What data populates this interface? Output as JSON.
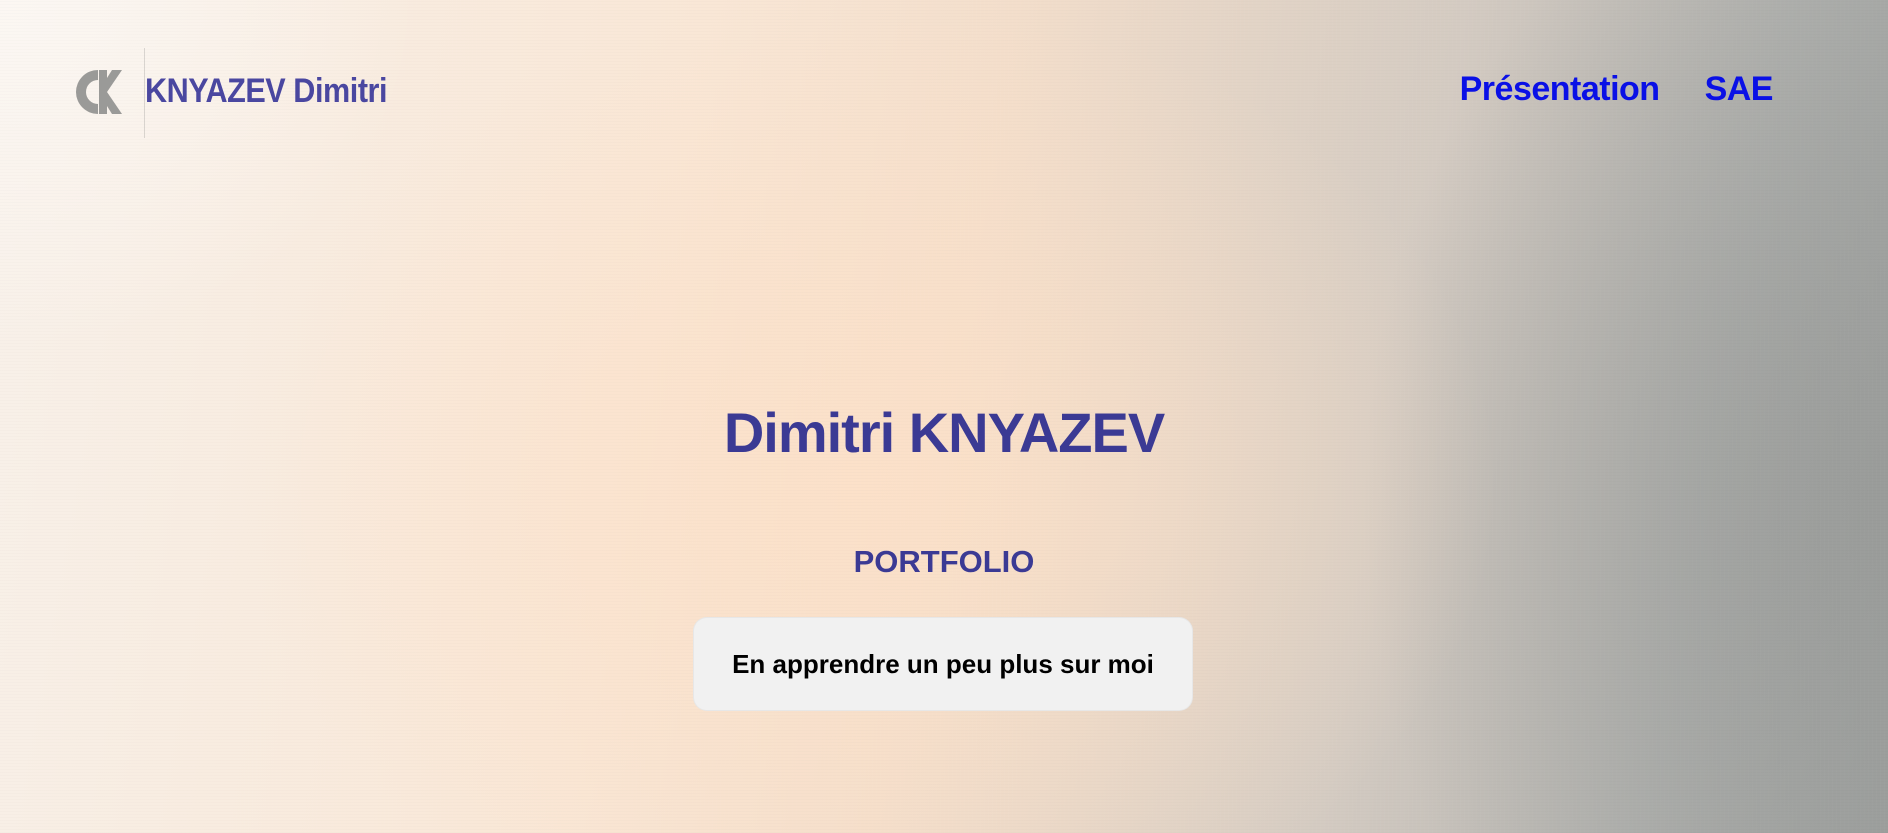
{
  "header": {
    "logo_icon": "ck-monogram-icon",
    "brand_name": "KNYAZEV Dimitri",
    "nav": [
      {
        "label": "Présentation"
      },
      {
        "label": "SAE"
      }
    ]
  },
  "hero": {
    "title": "Dimitri KNYAZEV",
    "subtitle": "PORTFOLIO",
    "cta_label": "En apprendre un peu plus sur moi"
  },
  "colors": {
    "brand": "#4a47a0",
    "heading": "#3b3a94",
    "nav_link": "#0a10e6",
    "button_bg": "#f1f1f1",
    "logo_gray": "#9a9a98"
  }
}
